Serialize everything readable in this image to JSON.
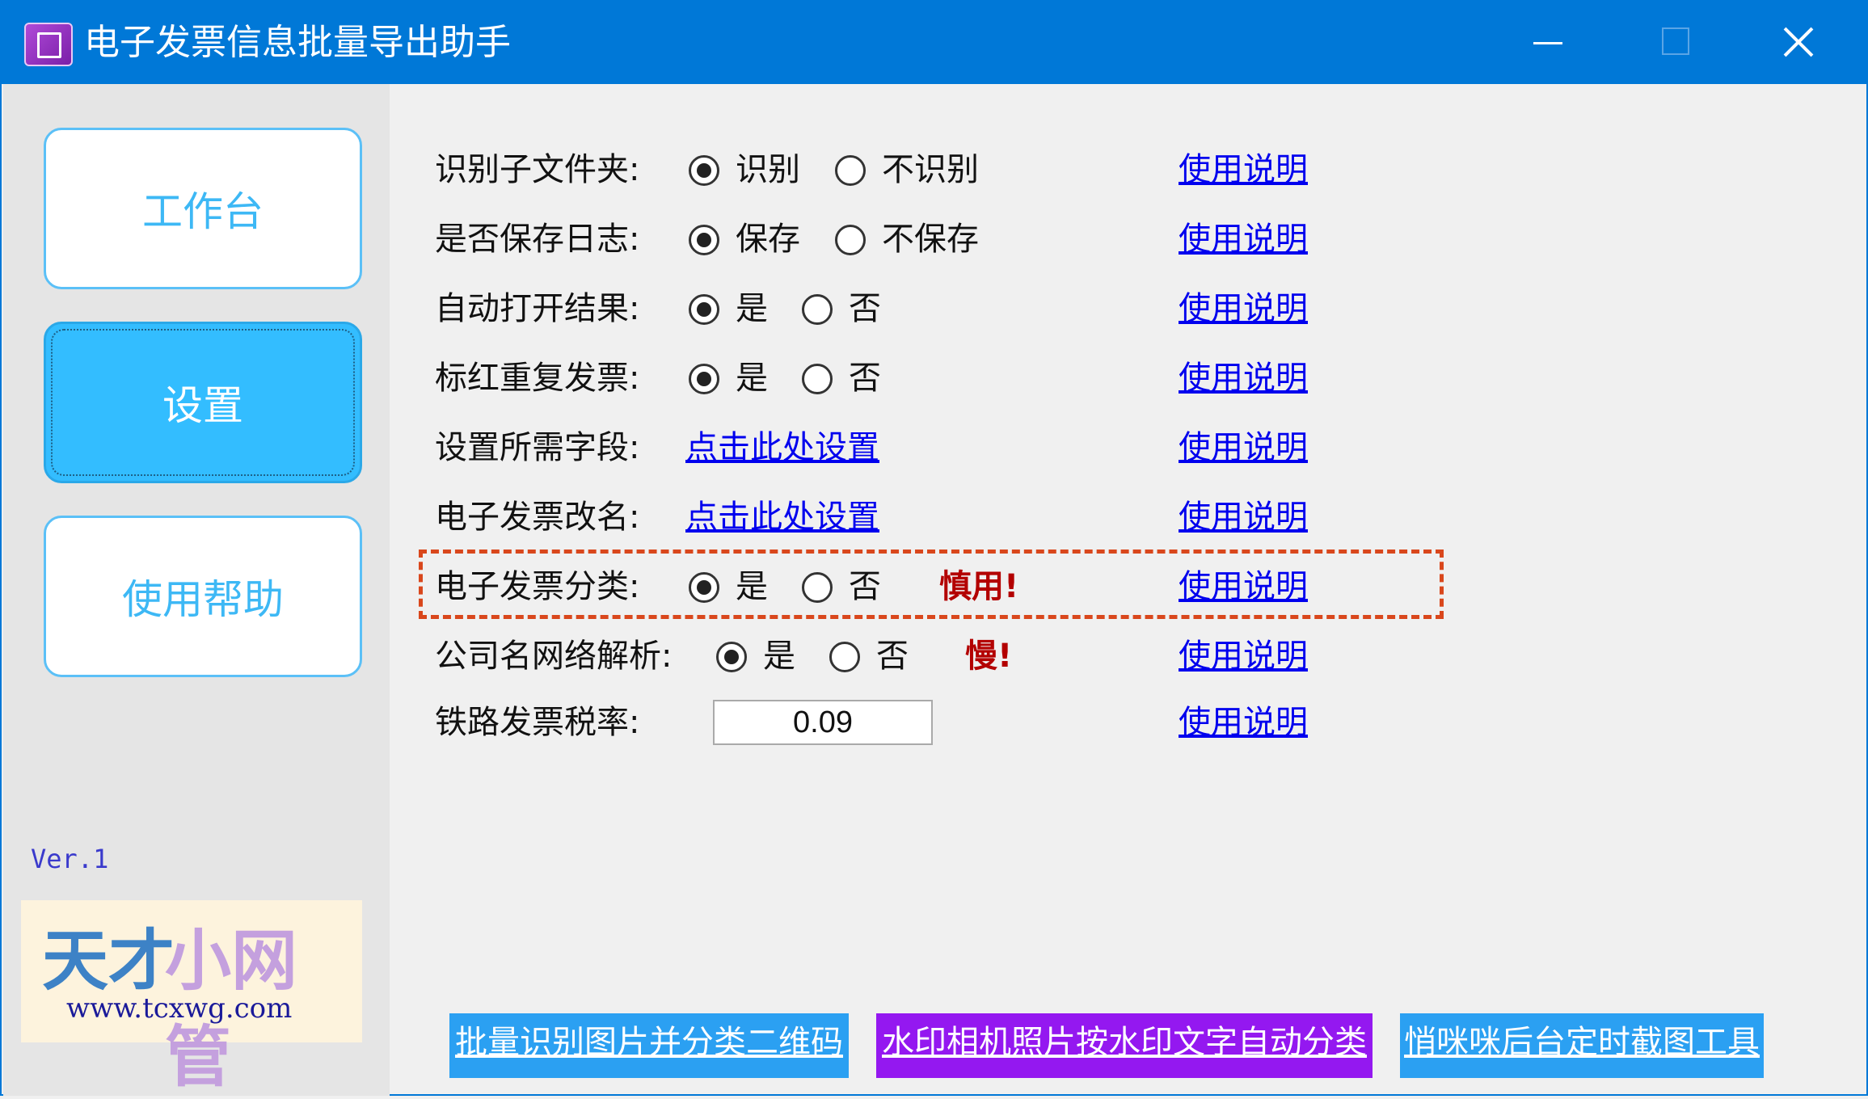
{
  "window": {
    "title": "电子发票信息批量导出助手",
    "icons": {
      "app": "app-icon",
      "minimize": "minimize-icon",
      "maximize": "maximize-icon",
      "close": "close-icon"
    }
  },
  "sidebar": {
    "nav": [
      {
        "label": "工作台",
        "selected": false
      },
      {
        "label": "设置",
        "selected": true
      },
      {
        "label": "使用帮助",
        "selected": false
      }
    ],
    "version": "Ver.1",
    "logo": {
      "part1": "天才",
      "part2": "小网管",
      "url": "www.tcxwg.com"
    }
  },
  "settings": {
    "help_link": "使用说明",
    "rows": [
      {
        "label": "识别子文件夹:",
        "options": [
          "识别",
          "不识别"
        ],
        "selected": 0
      },
      {
        "label": "是否保存日志:",
        "options": [
          "保存",
          "不保存"
        ],
        "selected": 0
      },
      {
        "label": "自动打开结果:",
        "options": [
          "是",
          "否"
        ],
        "selected": 0
      },
      {
        "label": "标红重复发票:",
        "options": [
          "是",
          "否"
        ],
        "selected": 0
      },
      {
        "label": "设置所需字段:",
        "link": "点击此处设置"
      },
      {
        "label": "电子发票改名:",
        "link": "点击此处设置"
      },
      {
        "label": "电子发票分类:",
        "options": [
          "是",
          "否"
        ],
        "selected": 0,
        "warning": "慎用!"
      },
      {
        "label": "公司名网络解析:",
        "options": [
          "是",
          "否"
        ],
        "selected": 0,
        "warning": "慢!"
      },
      {
        "label": "铁路发票税率:",
        "value": "0.09"
      }
    ]
  },
  "footer_buttons": [
    {
      "label": "批量识别图片并分类二维码",
      "color": "#2ba0f2"
    },
    {
      "label": "水印相机照片按水印文字自动分类",
      "color": "#9418f0"
    },
    {
      "label": "悄咪咪后台定时截图工具",
      "color": "#2ba0f2"
    }
  ]
}
